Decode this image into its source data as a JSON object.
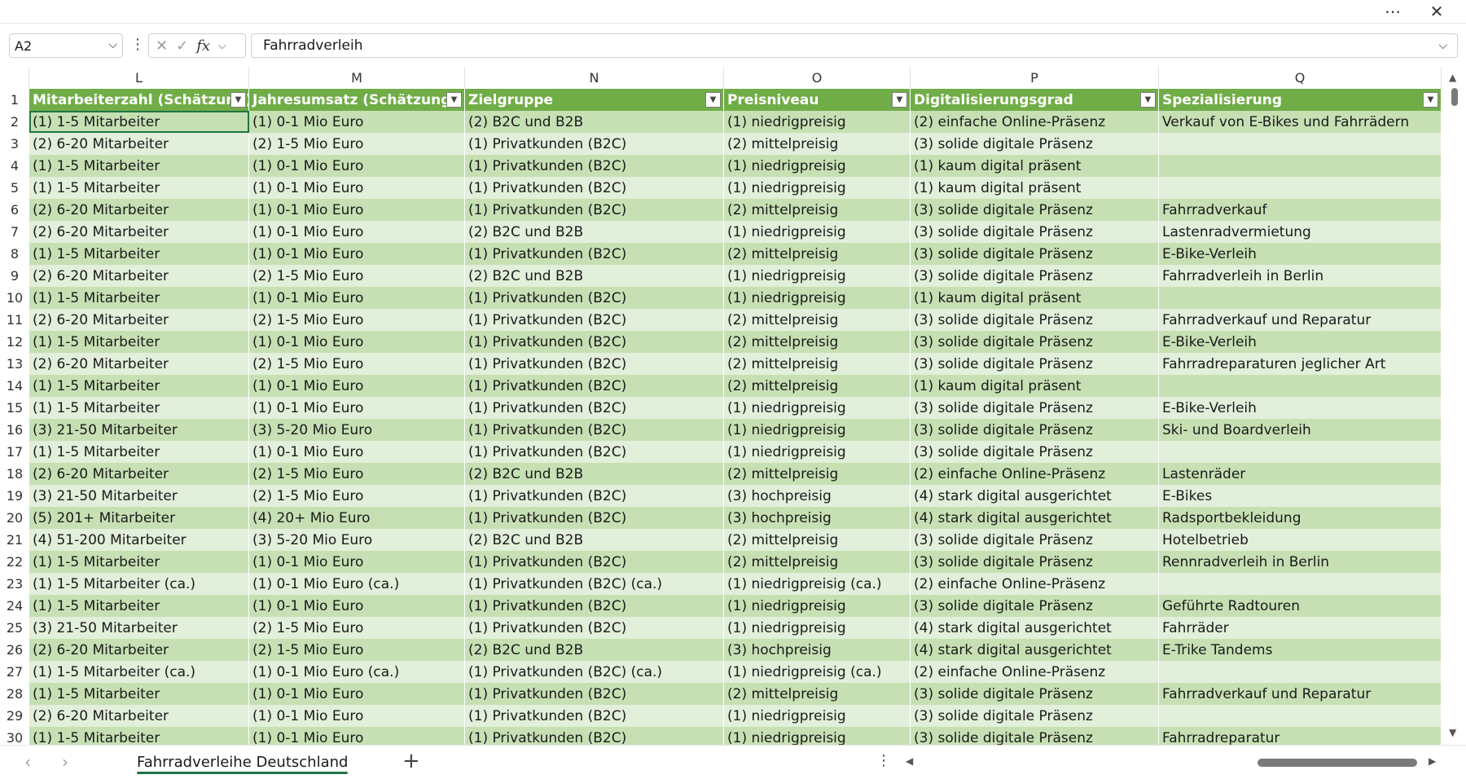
{
  "window": {
    "more_label": "⋯",
    "close_label": "✕"
  },
  "formula_bar": {
    "name_box": "A2",
    "cancel_icon": "✕",
    "confirm_icon": "✓",
    "fx_label": "fx",
    "formula": "Fahrradverleih"
  },
  "columns": [
    "L",
    "M",
    "N",
    "O",
    "P",
    "Q"
  ],
  "headers": [
    "Mitarbeiterzahl (Schätzung)",
    "Jahresumsatz (Schätzung)",
    "Zielgruppe",
    "Preisniveau",
    "Digitalisierungsgrad",
    "Spezialisierung"
  ],
  "rows": [
    {
      "num": "2",
      "cells": [
        "(1) 1-5 Mitarbeiter",
        "(1) 0-1 Mio Euro",
        "(2) B2C und B2B",
        "(1) niedrigpreisig",
        "(2) einfache Online-Präsenz",
        "Verkauf von E-Bikes und Fahrrädern"
      ]
    },
    {
      "num": "3",
      "cells": [
        "(2) 6-20 Mitarbeiter",
        "(2) 1-5 Mio Euro",
        "(1) Privatkunden (B2C)",
        "(2) mittelpreisig",
        "(3) solide digitale Präsenz",
        ""
      ]
    },
    {
      "num": "4",
      "cells": [
        "(1) 1-5 Mitarbeiter",
        "(1) 0-1 Mio Euro",
        "(1) Privatkunden (B2C)",
        "(1) niedrigpreisig",
        "(1) kaum digital präsent",
        ""
      ]
    },
    {
      "num": "5",
      "cells": [
        "(1) 1-5 Mitarbeiter",
        "(1) 0-1 Mio Euro",
        "(1) Privatkunden (B2C)",
        "(1) niedrigpreisig",
        "(1) kaum digital präsent",
        ""
      ]
    },
    {
      "num": "6",
      "cells": [
        "(2) 6-20 Mitarbeiter",
        "(1) 0-1 Mio Euro",
        "(1) Privatkunden (B2C)",
        "(2) mittelpreisig",
        "(3) solide digitale Präsenz",
        "Fahrradverkauf"
      ]
    },
    {
      "num": "7",
      "cells": [
        "(2) 6-20 Mitarbeiter",
        "(1) 0-1 Mio Euro",
        "(2) B2C und B2B",
        "(1) niedrigpreisig",
        "(3) solide digitale Präsenz",
        "Lastenradvermietung"
      ]
    },
    {
      "num": "8",
      "cells": [
        "(1) 1-5 Mitarbeiter",
        "(1) 0-1 Mio Euro",
        "(1) Privatkunden (B2C)",
        "(2) mittelpreisig",
        "(3) solide digitale Präsenz",
        "E-Bike-Verleih"
      ]
    },
    {
      "num": "9",
      "cells": [
        "(2) 6-20 Mitarbeiter",
        "(2) 1-5 Mio Euro",
        "(2) B2C und B2B",
        "(1) niedrigpreisig",
        "(3) solide digitale Präsenz",
        "Fahrradverleih in Berlin"
      ]
    },
    {
      "num": "10",
      "cells": [
        "(1) 1-5 Mitarbeiter",
        "(1) 0-1 Mio Euro",
        "(1) Privatkunden (B2C)",
        "(1) niedrigpreisig",
        "(1) kaum digital präsent",
        ""
      ]
    },
    {
      "num": "11",
      "cells": [
        "(2) 6-20 Mitarbeiter",
        "(2) 1-5 Mio Euro",
        "(1) Privatkunden (B2C)",
        "(2) mittelpreisig",
        "(3) solide digitale Präsenz",
        "Fahrradverkauf und Reparatur"
      ]
    },
    {
      "num": "12",
      "cells": [
        "(1) 1-5 Mitarbeiter",
        "(1) 0-1 Mio Euro",
        "(1) Privatkunden (B2C)",
        "(2) mittelpreisig",
        "(3) solide digitale Präsenz",
        "E-Bike-Verleih"
      ]
    },
    {
      "num": "13",
      "cells": [
        "(2) 6-20 Mitarbeiter",
        "(2) 1-5 Mio Euro",
        "(1) Privatkunden (B2C)",
        "(2) mittelpreisig",
        "(3) solide digitale Präsenz",
        "Fahrradreparaturen jeglicher Art"
      ]
    },
    {
      "num": "14",
      "cells": [
        "(1) 1-5 Mitarbeiter",
        "(1) 0-1 Mio Euro",
        "(1) Privatkunden (B2C)",
        "(2) mittelpreisig",
        "(1) kaum digital präsent",
        ""
      ]
    },
    {
      "num": "15",
      "cells": [
        "(1) 1-5 Mitarbeiter",
        "(1) 0-1 Mio Euro",
        "(1) Privatkunden (B2C)",
        "(1) niedrigpreisig",
        "(3) solide digitale Präsenz",
        "E-Bike-Verleih"
      ]
    },
    {
      "num": "16",
      "cells": [
        "(3) 21-50 Mitarbeiter",
        "(3) 5-20 Mio Euro",
        "(1) Privatkunden (B2C)",
        "(1) niedrigpreisig",
        "(3) solide digitale Präsenz",
        "Ski- und Boardverleih"
      ]
    },
    {
      "num": "17",
      "cells": [
        "(1) 1-5 Mitarbeiter",
        "(1) 0-1 Mio Euro",
        "(1) Privatkunden (B2C)",
        "(1) niedrigpreisig",
        "(3) solide digitale Präsenz",
        ""
      ]
    },
    {
      "num": "18",
      "cells": [
        "(2) 6-20 Mitarbeiter",
        "(2) 1-5 Mio Euro",
        "(2) B2C und B2B",
        "(2) mittelpreisig",
        "(2) einfache Online-Präsenz",
        "Lastenräder"
      ]
    },
    {
      "num": "19",
      "cells": [
        "(3) 21-50 Mitarbeiter",
        "(2) 1-5 Mio Euro",
        "(1) Privatkunden (B2C)",
        "(3) hochpreisig",
        "(4) stark digital ausgerichtet",
        "E-Bikes"
      ]
    },
    {
      "num": "20",
      "cells": [
        "(5) 201+ Mitarbeiter",
        "(4) 20+ Mio Euro",
        "(1) Privatkunden (B2C)",
        "(3) hochpreisig",
        "(4) stark digital ausgerichtet",
        "Radsportbekleidung"
      ]
    },
    {
      "num": "21",
      "cells": [
        "(4) 51-200 Mitarbeiter",
        "(3) 5-20 Mio Euro",
        "(2) B2C und B2B",
        "(2) mittelpreisig",
        "(3) solide digitale Präsenz",
        "Hotelbetrieb"
      ]
    },
    {
      "num": "22",
      "cells": [
        "(1) 1-5 Mitarbeiter",
        "(1) 0-1 Mio Euro",
        "(1) Privatkunden (B2C)",
        "(2) mittelpreisig",
        "(3) solide digitale Präsenz",
        "Rennradverleih in Berlin"
      ]
    },
    {
      "num": "23",
      "cells": [
        "(1) 1-5 Mitarbeiter (ca.)",
        "(1) 0-1 Mio Euro (ca.)",
        "(1) Privatkunden (B2C) (ca.)",
        "(1) niedrigpreisig (ca.)",
        "(2) einfache Online-Präsenz",
        ""
      ]
    },
    {
      "num": "24",
      "cells": [
        "(1) 1-5 Mitarbeiter",
        "(1) 0-1 Mio Euro",
        "(1) Privatkunden (B2C)",
        "(1) niedrigpreisig",
        "(3) solide digitale Präsenz",
        "Geführte Radtouren"
      ]
    },
    {
      "num": "25",
      "cells": [
        "(3) 21-50 Mitarbeiter",
        "(2) 1-5 Mio Euro",
        "(1) Privatkunden (B2C)",
        "(1) niedrigpreisig",
        "(4) stark digital ausgerichtet",
        "Fahrräder"
      ]
    },
    {
      "num": "26",
      "cells": [
        "(2) 6-20 Mitarbeiter",
        "(2) 1-5 Mio Euro",
        "(2) B2C und B2B",
        "(3) hochpreisig",
        "(4) stark digital ausgerichtet",
        "E-Trike Tandems"
      ]
    },
    {
      "num": "27",
      "cells": [
        "(1) 1-5 Mitarbeiter (ca.)",
        "(1) 0-1 Mio Euro (ca.)",
        "(1) Privatkunden (B2C) (ca.)",
        "(1) niedrigpreisig (ca.)",
        "(2) einfache Online-Präsenz",
        ""
      ]
    },
    {
      "num": "28",
      "cells": [
        "(1) 1-5 Mitarbeiter",
        "(1) 0-1 Mio Euro",
        "(1) Privatkunden (B2C)",
        "(2) mittelpreisig",
        "(3) solide digitale Präsenz",
        "Fahrradverkauf und Reparatur"
      ]
    },
    {
      "num": "29",
      "cells": [
        "(2) 6-20 Mitarbeiter",
        "(1) 0-1 Mio Euro",
        "(1) Privatkunden (B2C)",
        "(1) niedrigpreisig",
        "(3) solide digitale Präsenz",
        ""
      ]
    },
    {
      "num": "30",
      "cells": [
        "(1) 1-5 Mitarbeiter",
        "(1) 0-1 Mio Euro",
        "(1) Privatkunden (B2C)",
        "(1) niedrigpreisig",
        "(3) solide digitale Präsenz",
        "Fahrradreparatur"
      ]
    }
  ],
  "sheet_tabs": {
    "prev_label": "‹",
    "next_label": "›",
    "active_tab": "Fahrradverleihe Deutschland",
    "add_label": "+",
    "more_label": "⋮"
  },
  "colors": {
    "header_bg": "#70ad47",
    "band_dark": "#c6e0b4",
    "band_light": "#e2efda",
    "accent": "#217346"
  }
}
